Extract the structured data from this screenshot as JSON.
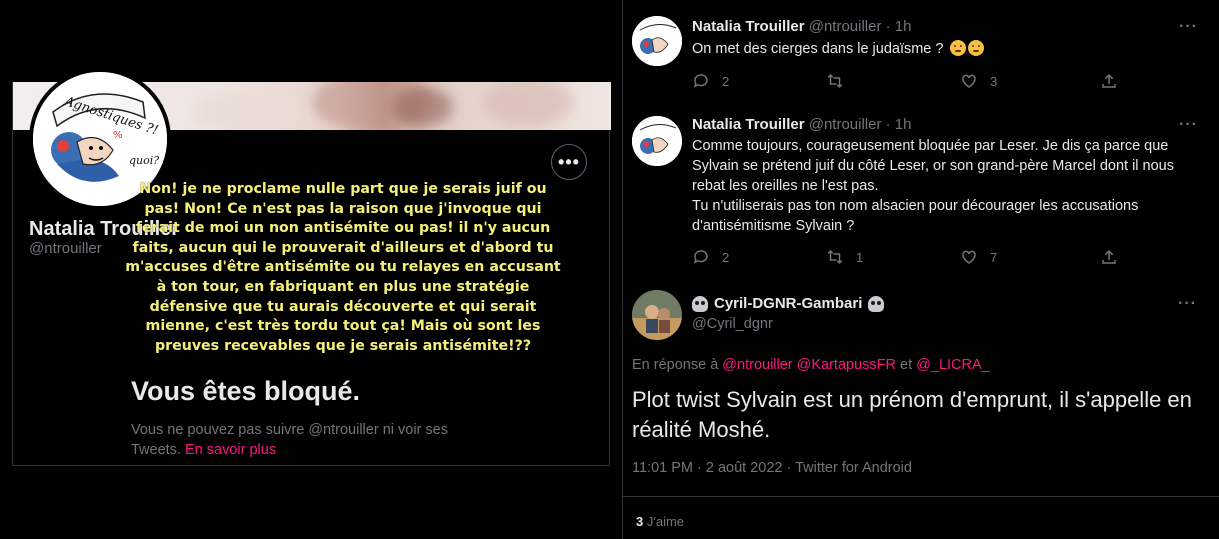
{
  "profile": {
    "name": "Natalia Trouiller",
    "handle": "@ntrouiller",
    "more_label": "•••",
    "overlay_text": "Non! je ne proclame nulle part que je serais juif ou pas! Non! Ce n'est pas la raison que j'invoque qui ferait de moi un non antisémite ou pas! il n'y aucun faits, aucun qui le prouverait d'ailleurs et d'abord tu m'accuses d'être antisémite ou tu relayes en accusant à ton tour, en fabriquant en plus une stratégie défensive que tu aurais découverte et qui serait mienne, c'est très tordu tout ça! Mais où sont les preuves recevables que je serais antisémite!??",
    "avatar_text": "Agnostiques ?!",
    "blocked_title": "Vous êtes bloqué.",
    "blocked_desc": "Vous ne pouvez pas suivre @ntrouiller ni voir ses Tweets.",
    "learn_more": "En savoir plus"
  },
  "tweets": [
    {
      "name": "Natalia Trouiller",
      "handle": "@ntrouiller · 1h",
      "text": "On met des cierges dans le judaïsme ?",
      "emoji": "thinking-face",
      "replies": "2",
      "retweets": "",
      "likes": "3"
    },
    {
      "name": "Natalia Trouiller",
      "handle": "@ntrouiller · 1h",
      "text": "Comme toujours, courageusement bloquée par Leser. Je dis ça parce que Sylvain se prétend juif du côté Leser, or son grand-père Marcel dont il nous rebat les oreilles ne l'est pas.",
      "text2": "Tu n'utiliserais pas ton nom alsacien pour décourager les accusations d'antisémitisme Sylvain ?",
      "replies": "2",
      "retweets": "1",
      "likes": "7"
    }
  ],
  "main_tweet": {
    "name": "Cyril-DGNR-Gambari",
    "handle": "@Cyril_dgnr",
    "reply_prefix": "En réponse à",
    "reply_mentions": "@ntrouiller @KartapussFR",
    "reply_and": "et",
    "reply_last": "@_LICRA_",
    "text": "Plot twist Sylvain est un prénom d'emprunt, il s'appelle en réalité Moshé.",
    "meta": "11:01 PM · 2 août 2022 · Twitter for Android",
    "likes_count": "3",
    "likes_label": "J'aime"
  },
  "colors": {
    "background": "#000000",
    "text": "#e7e9ea",
    "muted": "#71767b",
    "accent": "#f91880",
    "overlay_yellow": "#f4f07a"
  }
}
